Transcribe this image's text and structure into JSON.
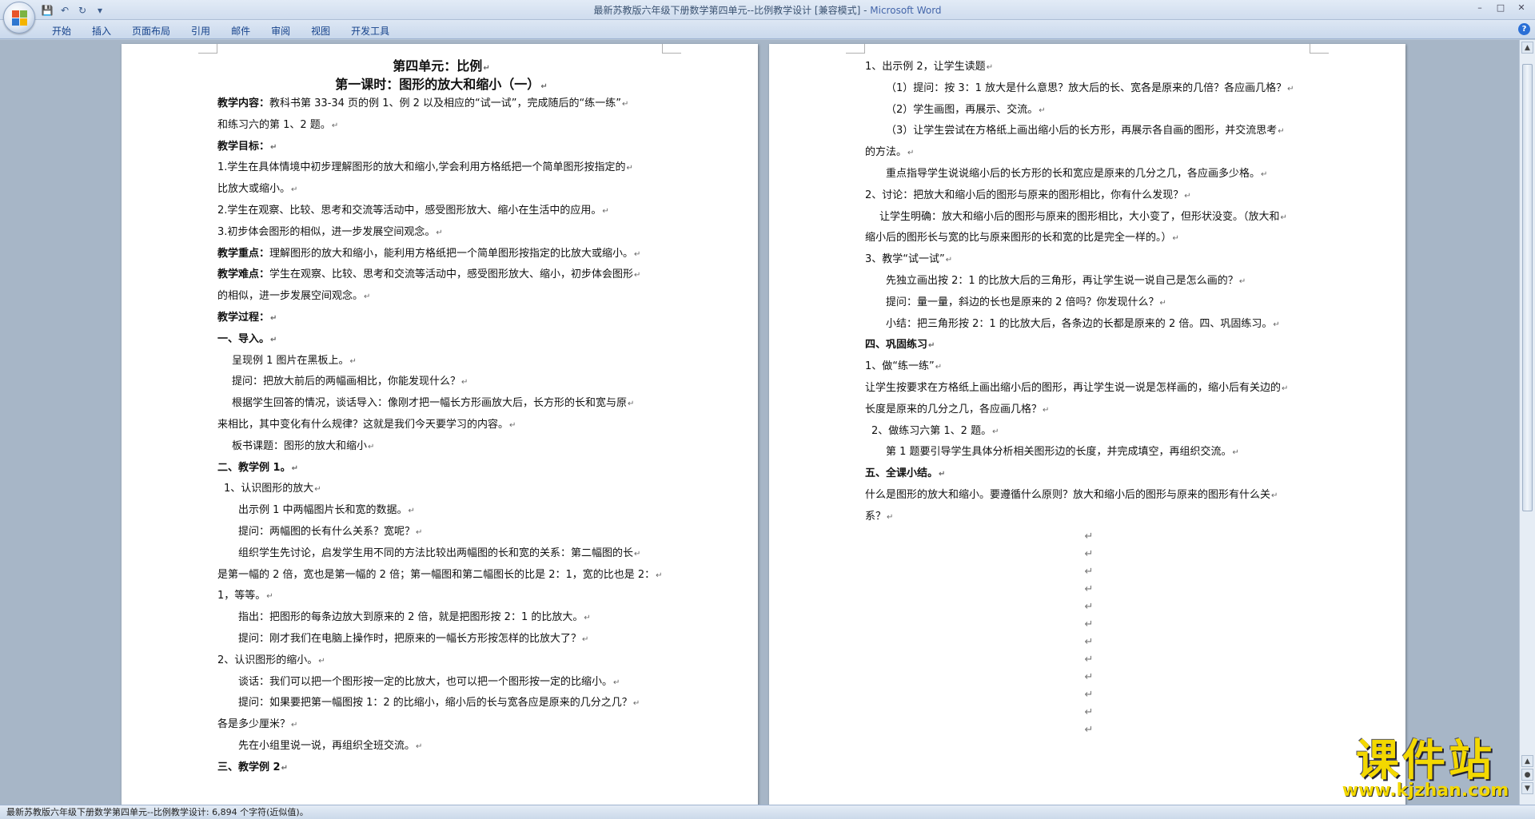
{
  "window": {
    "title": "最新苏教版六年级下册数学第四单元--比例教学设计 [兼容模式] -",
    "app_name": "Microsoft Word",
    "controls": [
      "–",
      "□",
      "✕"
    ]
  },
  "quick_access": {
    "save": "💾",
    "undo": "↶",
    "redo": "↻",
    "customize": "▾"
  },
  "ribbon": {
    "tabs": [
      "开始",
      "插入",
      "页面布局",
      "引用",
      "邮件",
      "审阅",
      "视图",
      "开发工具"
    ],
    "help": "?"
  },
  "left_page": {
    "lines": [
      {
        "text": "第四单元：比例",
        "style": "title"
      },
      {
        "text": "第一课时：图形的放大和缩小（一）",
        "style": "title"
      },
      {
        "label": "教学内容：",
        "text": "教科书第 33-34 页的例 1、例 2 以及相应的“试一试”，完成随后的“练一练”",
        "style": "label"
      },
      {
        "text": "和练习六的第 1、2 题。",
        "style": "plain"
      },
      {
        "text": "教学目标：",
        "style": "bold"
      },
      {
        "text": "1.学生在具体情境中初步理解图形的放大和缩小,学会利用方格纸把一个简单图形按指定的",
        "style": "plain"
      },
      {
        "text": "比放大或缩小。",
        "style": "plain"
      },
      {
        "text": "2.学生在观察、比较、思考和交流等活动中，感受图形放大、缩小在生活中的应用。",
        "style": "plain"
      },
      {
        "text": "3.初步体会图形的相似，进一步发展空间观念。",
        "style": "plain"
      },
      {
        "label": "教学重点：",
        "text": "理解图形的放大和缩小，能利用方格纸把一个简单图形按指定的比放大或缩小。",
        "style": "label"
      },
      {
        "label": "教学难点：",
        "text": "学生在观察、比较、思考和交流等活动中，感受图形放大、缩小，初步体会图形",
        "style": "label"
      },
      {
        "text": "的相似，进一步发展空间观念。",
        "style": "plain"
      },
      {
        "text": "教学过程：",
        "style": "bold"
      },
      {
        "text": "一、导入。",
        "style": "bold"
      },
      {
        "text": "呈现例 1 图片在黑板上。",
        "style": "indent2"
      },
      {
        "text": "提问：把放大前后的两幅画相比，你能发现什么？",
        "style": "indent2"
      },
      {
        "text": "根据学生回答的情况，谈话导入：像刚才把一幅长方形画放大后，长方形的长和宽与原",
        "style": "indent2"
      },
      {
        "text": "来相比，其中变化有什么规律？这就是我们今天要学习的内容。",
        "style": "plain"
      },
      {
        "text": "板书课题：图形的放大和缩小",
        "style": "indent2"
      },
      {
        "text": "二、教学例 1。",
        "style": "bold"
      },
      {
        "text": "1、认识图形的放大",
        "style": "indent1"
      },
      {
        "text": "出示例 1 中两幅图片长和宽的数据。",
        "style": "indent3"
      },
      {
        "text": "提问：两幅图的长有什么关系？宽呢？",
        "style": "indent3"
      },
      {
        "text": "组织学生先讨论，启发学生用不同的方法比较出两幅图的长和宽的关系：第二幅图的长",
        "style": "indent3"
      },
      {
        "text": "是第一幅的 2 倍，宽也是第一幅的 2 倍；第一幅图和第二幅图长的比是 2：1，宽的比也是 2：",
        "style": "plain"
      },
      {
        "text": "1，等等。",
        "style": "plain"
      },
      {
        "text": "指出：把图形的每条边放大到原来的 2 倍，就是把图形按 2：1 的比放大。",
        "style": "indent3"
      },
      {
        "text": "提问：刚才我们在电脑上操作时，把原来的一幅长方形按怎样的比放大了？",
        "style": "indent3"
      },
      {
        "text": "2、认识图形的缩小。",
        "style": "plain"
      },
      {
        "text": "谈话：我们可以把一个图形按一定的比放大，也可以把一个图形按一定的比缩小。",
        "style": "indent3"
      },
      {
        "text": "提问：如果要把第一幅图按 1：2 的比缩小，缩小后的长与宽各应是原来的几分之几？",
        "style": "indent3"
      },
      {
        "text": "各是多少厘米？",
        "style": "plain"
      },
      {
        "text": "先在小组里说一说，再组织全班交流。",
        "style": "indent3"
      },
      {
        "text": "三、教学例 2",
        "style": "bold"
      }
    ]
  },
  "right_page": {
    "lines": [
      {
        "text": "1、出示例 2，让学生读题",
        "style": "plain"
      },
      {
        "text": "（1）提问：按 3：1 放大是什么意思？放大后的长、宽各是原来的几倍？各应画几格？",
        "style": "indent3"
      },
      {
        "text": "（2）学生画图，再展示、交流。",
        "style": "indent3"
      },
      {
        "text": "（3）让学生尝试在方格纸上画出缩小后的长方形，再展示各自画的图形，并交流思考",
        "style": "indent3"
      },
      {
        "text": "的方法。",
        "style": "plain"
      },
      {
        "text": "重点指导学生说说缩小后的长方形的长和宽应是原来的几分之几，各应画多少格。",
        "style": "indent3"
      },
      {
        "text": "2、讨论：把放大和缩小后的图形与原来的图形相比，你有什么发现？",
        "style": "plain"
      },
      {
        "text": "让学生明确：放大和缩小后的图形与原来的图形相比，大小变了，但形状没变。（放大和",
        "style": "indent2"
      },
      {
        "text": "缩小后的图形长与宽的比与原来图形的长和宽的比是完全一样的。）",
        "style": "plain"
      },
      {
        "text": "3、教学“试一试”",
        "style": "plain"
      },
      {
        "text": "先独立画出按 2：1 的比放大后的三角形，再让学生说一说自己是怎么画的？",
        "style": "indent3"
      },
      {
        "text": "提问：量一量，斜边的长也是原来的 2 倍吗？你发现什么？",
        "style": "indent3"
      },
      {
        "text": "小结：把三角形按 2：1 的比放大后，各条边的长都是原来的 2 倍。四、巩固练习。",
        "style": "indent3"
      },
      {
        "text": "四、巩固练习",
        "style": "bold"
      },
      {
        "text": "1、做“练一练”",
        "style": "plain"
      },
      {
        "text": "让学生按要求在方格纸上画出缩小后的图形，再让学生说一说是怎样画的，缩小后有关边的",
        "style": "plain"
      },
      {
        "text": "长度是原来的几分之几，各应画几格？",
        "style": "plain"
      },
      {
        "text": "2、做练习六第 1、2 题。",
        "style": "indent1"
      },
      {
        "text": "第 1 题要引导学生具体分析相关图形边的长度，并完成填空，再组织交流。",
        "style": "indent3"
      },
      {
        "text": "五、全课小结。",
        "style": "bold"
      },
      {
        "text": "什么是图形的放大和缩小。要遵循什么原则？放大和缩小后的图形与原来的图形有什么关",
        "style": "plain"
      },
      {
        "text": "系？",
        "style": "plain"
      }
    ],
    "empty_paragraphs": 12
  },
  "paragraph_mark": "↵",
  "statusbar": {
    "text": "最新苏教版六年级下册数学第四单元--比例教学设计: 6,894 个字符(近似值)。"
  },
  "watermark": {
    "main": "课件站",
    "url": "www.kjzhan.com"
  }
}
